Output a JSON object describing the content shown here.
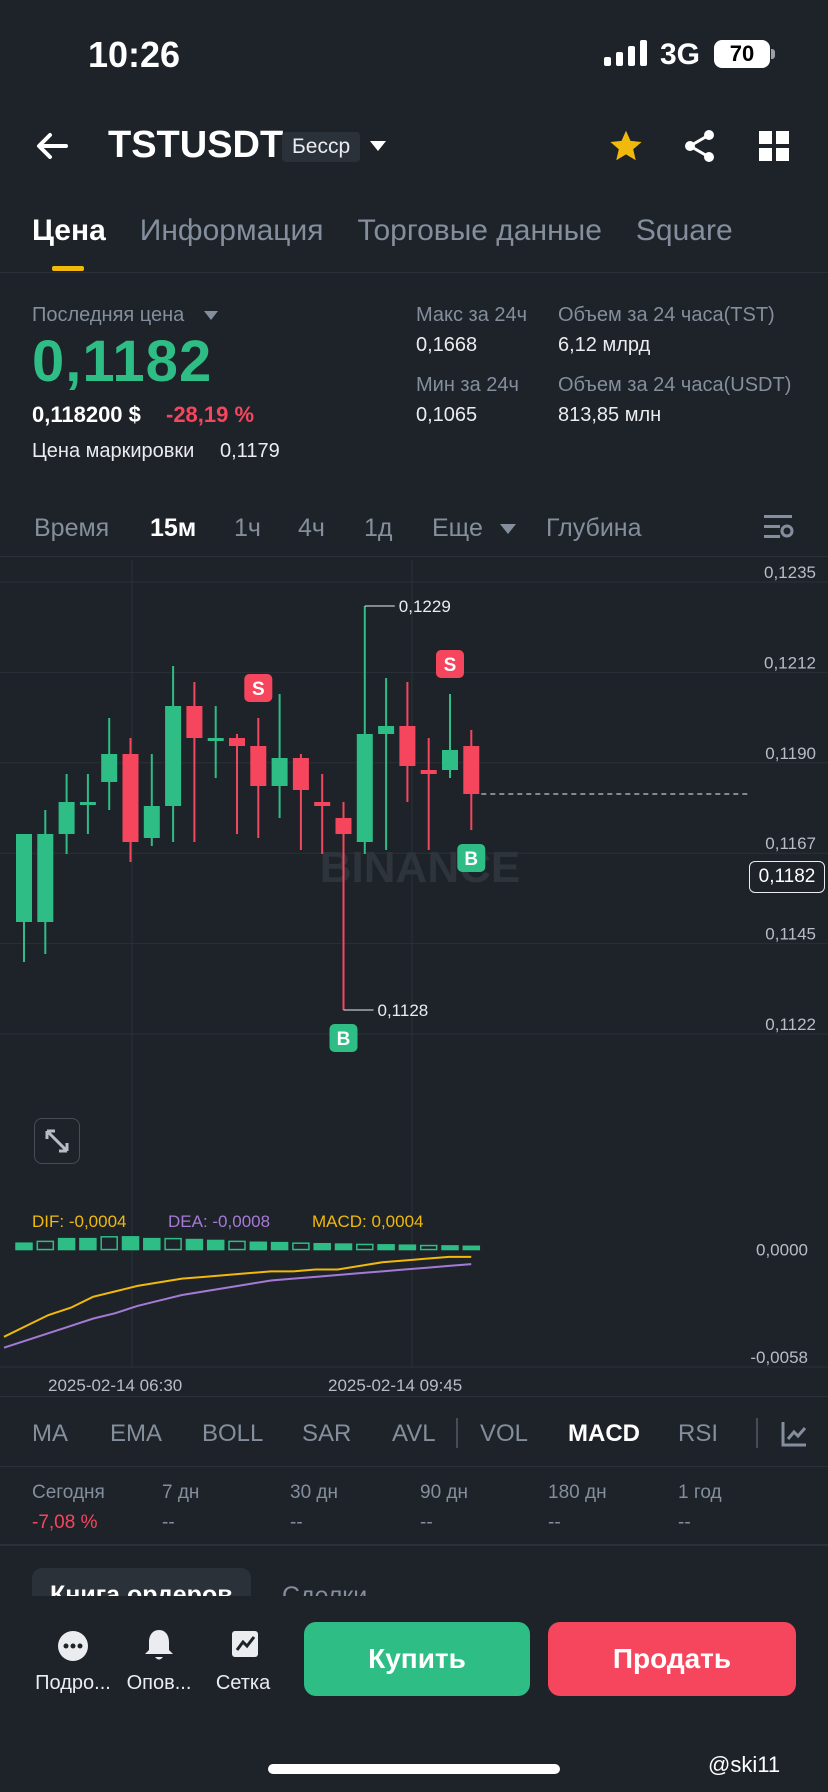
{
  "status": {
    "time": "10:26",
    "network": "3G",
    "battery": "70"
  },
  "header": {
    "pair": "TSTUSDT",
    "contract_type": "Бесср"
  },
  "tabs": [
    "Цена",
    "Информация",
    "Торговые данные",
    "Square"
  ],
  "stats": {
    "last_price_label": "Последняя цена",
    "last_price": "0,1182",
    "usd_price": "0,118200 $",
    "change": "-28,19 %",
    "mark_label": "Цена маркировки",
    "mark_value": "0,1179",
    "high_label": "Макс за 24ч",
    "high_value": "0,1668",
    "low_label": "Мин за 24ч",
    "low_value": "0,1065",
    "vol_base_label": "Объем за 24 часа(TST)",
    "vol_base_value": "6,12 млрд",
    "vol_quote_label": "Объем за 24 часа(USDT)",
    "vol_quote_value": "813,85 млн"
  },
  "timeframes": {
    "time": "Время",
    "m15": "15м",
    "h1": "1ч",
    "h4": "4ч",
    "d1": "1д",
    "more": "Еще",
    "depth": "Глубина"
  },
  "chart_data": {
    "type": "candlestick",
    "price_axis": [
      "0,1235",
      "0,1212",
      "0,1190",
      "0,1167",
      "0,1145",
      "0,1122"
    ],
    "y_range": [
      0.1122,
      0.1235
    ],
    "current_price": "0,1182",
    "high_marker": "0,1229",
    "low_marker": "0,1128",
    "candles": [
      {
        "o": 0.115,
        "h": 0.1172,
        "l": 0.114,
        "c": 0.1172
      },
      {
        "o": 0.115,
        "h": 0.1178,
        "l": 0.1142,
        "c": 0.1172
      },
      {
        "o": 0.1172,
        "h": 0.1187,
        "l": 0.1167,
        "c": 0.118
      },
      {
        "o": 0.118,
        "h": 0.1187,
        "l": 0.1172,
        "c": 0.118
      },
      {
        "o": 0.1185,
        "h": 0.1201,
        "l": 0.1178,
        "c": 0.1192
      },
      {
        "o": 0.1192,
        "h": 0.1196,
        "l": 0.1165,
        "c": 0.117
      },
      {
        "o": 0.1171,
        "h": 0.1192,
        "l": 0.1169,
        "c": 0.1179
      },
      {
        "o": 0.1179,
        "h": 0.1214,
        "l": 0.117,
        "c": 0.1204
      },
      {
        "o": 0.1204,
        "h": 0.121,
        "l": 0.117,
        "c": 0.1196
      },
      {
        "o": 0.1196,
        "h": 0.1204,
        "l": 0.1186,
        "c": 0.1196
      },
      {
        "o": 0.1196,
        "h": 0.1197,
        "l": 0.1172,
        "c": 0.1194
      },
      {
        "o": 0.1194,
        "h": 0.1201,
        "l": 0.1171,
        "c": 0.1184
      },
      {
        "o": 0.1184,
        "h": 0.1207,
        "l": 0.1176,
        "c": 0.1191
      },
      {
        "o": 0.1191,
        "h": 0.1192,
        "l": 0.1168,
        "c": 0.1183
      },
      {
        "o": 0.118,
        "h": 0.1187,
        "l": 0.1167,
        "c": 0.1179
      },
      {
        "o": 0.1176,
        "h": 0.118,
        "l": 0.1128,
        "c": 0.1172
      },
      {
        "o": 0.117,
        "h": 0.1229,
        "l": 0.1167,
        "c": 0.1197
      },
      {
        "o": 0.1197,
        "h": 0.1211,
        "l": 0.1168,
        "c": 0.1199
      },
      {
        "o": 0.1199,
        "h": 0.121,
        "l": 0.118,
        "c": 0.1189
      },
      {
        "o": 0.1188,
        "h": 0.1196,
        "l": 0.1168,
        "c": 0.1187
      },
      {
        "o": 0.1188,
        "h": 0.1207,
        "l": 0.1186,
        "c": 0.1193
      },
      {
        "o": 0.1194,
        "h": 0.1198,
        "l": 0.1173,
        "c": 0.1182
      }
    ],
    "markers": [
      {
        "label": "S",
        "candle": 11
      },
      {
        "label": "S",
        "candle": 20
      },
      {
        "label": "B",
        "candle": 21
      },
      {
        "label": "B",
        "candle": 15
      }
    ],
    "macd_axis": [
      "0,0000",
      "-0,0058"
    ],
    "macd_legend": {
      "dif": "DIF: -0,0004",
      "dea": "DEA: -0,0008",
      "macd": "MACD: 0,0004"
    },
    "macd_hist": [
      0.00035,
      0.00045,
      0.0006,
      0.0006,
      0.0007,
      0.0007,
      0.0006,
      0.0006,
      0.00055,
      0.0005,
      0.00045,
      0.0004,
      0.00038,
      0.00035,
      0.00032,
      0.0003,
      0.00028,
      0.00026,
      0.00024,
      0.00022,
      0.0002,
      0.00018
    ],
    "dif": [
      -0.0048,
      -0.0042,
      -0.0036,
      -0.0032,
      -0.0026,
      -0.0023,
      -0.002,
      -0.0018,
      -0.0016,
      -0.0015,
      -0.0014,
      -0.0013,
      -0.0012,
      -0.0012,
      -0.0011,
      -0.0011,
      -0.0009,
      -0.0007,
      -0.0006,
      -0.0005,
      -0.0004,
      -0.0004
    ],
    "dea": [
      -0.0054,
      -0.005,
      -0.0046,
      -0.0042,
      -0.0038,
      -0.0035,
      -0.0031,
      -0.0028,
      -0.0025,
      -0.0023,
      -0.0021,
      -0.0019,
      -0.0017,
      -0.0016,
      -0.0015,
      -0.0014,
      -0.0013,
      -0.0012,
      -0.0011,
      -0.001,
      -0.0009,
      -0.0008
    ],
    "macd_range": [
      -0.0058,
      0.0008
    ],
    "time_labels": [
      "2025-02-14 06:30",
      "2025-02-14 09:45"
    ],
    "watermark": "BINANCE"
  },
  "indicators": [
    "MA",
    "EMA",
    "BOLL",
    "SAR",
    "AVL",
    "VOL",
    "MACD",
    "RSI"
  ],
  "performance": [
    {
      "label": "Сегодня",
      "value": "-7,08 %"
    },
    {
      "label": "7 дн",
      "value": "--"
    },
    {
      "label": "30 дн",
      "value": "--"
    },
    {
      "label": "90 дн",
      "value": "--"
    },
    {
      "label": "180 дн",
      "value": "--"
    },
    {
      "label": "1 год",
      "value": "--"
    }
  ],
  "book_tabs": [
    "Книга ордеров",
    "Сделки"
  ],
  "bottom": {
    "more": "Подро...",
    "alerts": "Опов...",
    "grid": "Сетка",
    "buy": "Купить",
    "sell": "Продать"
  },
  "colors": {
    "up": "#2ebd85",
    "down": "#f6465d",
    "accent": "#f0b90b",
    "bg": "#1e2329"
  },
  "watermark_user": "@ski11"
}
